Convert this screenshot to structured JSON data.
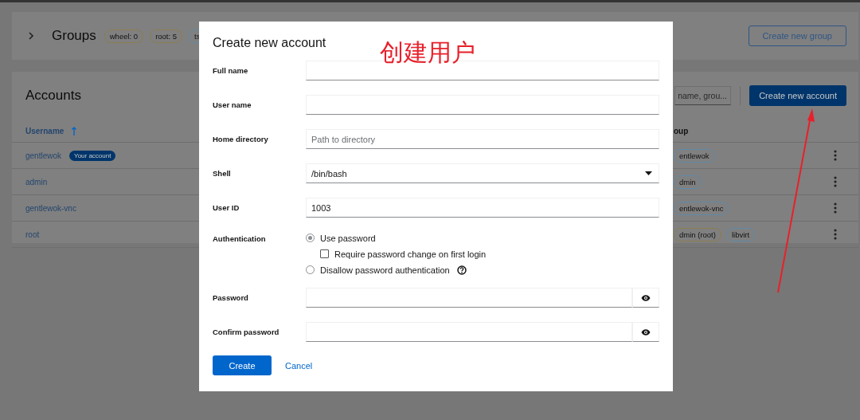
{
  "groups_card": {
    "title": "Groups",
    "expanded": false,
    "tags": [
      {
        "label": "wheel: 0",
        "color": "#8c7d4e"
      },
      {
        "label": "root: 5",
        "color": "#8c7d4e"
      },
      {
        "label": "ts",
        "color": "#5f8aa8"
      }
    ],
    "button": "Create new group"
  },
  "accounts_card": {
    "title": "Accounts",
    "search": {
      "placeholder": "name, grou..."
    },
    "button": "Create new account",
    "columns": [
      "Username",
      "oup"
    ],
    "rows": [
      {
        "username": "gentlewok",
        "badge": "Your account",
        "groups": [
          {
            "label": "entlewok",
            "color": "#5f8aa8"
          }
        ]
      },
      {
        "username": "admin",
        "groups": [
          {
            "label": "dmin",
            "color": "#5f8aa8"
          }
        ]
      },
      {
        "username": "gentlewok-vnc",
        "groups": [
          {
            "label": "entlewok-vnc",
            "color": "#5f8aa8"
          }
        ]
      },
      {
        "username": "root",
        "groups": [
          {
            "label": "dmin (root)",
            "color": "#8c7d4e"
          },
          {
            "label": "libvirt",
            "color": "#5f8aa8"
          }
        ]
      }
    ]
  },
  "dialog": {
    "title": "Create new account",
    "fields": [
      {
        "kind": "text",
        "label": "Full name"
      },
      {
        "kind": "text",
        "label": "User name"
      },
      {
        "kind": "text",
        "label": "Home directory",
        "placeholder": "Path to directory"
      },
      {
        "kind": "select",
        "label": "Shell",
        "value": "/bin/bash"
      },
      {
        "kind": "text",
        "label": "User ID",
        "value": "1003"
      },
      {
        "kind": "radios",
        "label": "Authentication",
        "options": [
          {
            "label": "Use password",
            "selected": true,
            "suboption": {
              "label": "Require password change on first login",
              "checked": false
            }
          },
          {
            "label": "Disallow password authentication",
            "selected": false,
            "help": true
          }
        ]
      },
      {
        "kind": "password",
        "label": "Password"
      },
      {
        "kind": "password",
        "label": "Confirm password"
      }
    ],
    "primary_button": "Create",
    "link_button": "Cancel"
  },
  "annotation": {
    "text": "创建用户"
  }
}
